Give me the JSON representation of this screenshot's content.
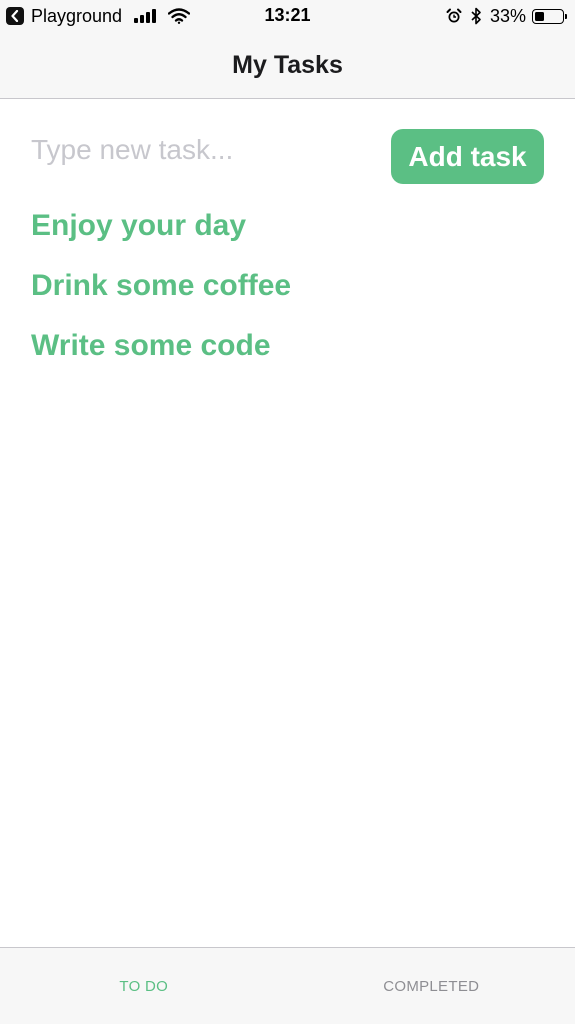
{
  "status_bar": {
    "back_app": "Playground",
    "time": "13:21",
    "battery_percent": "33%",
    "battery_level": 0.33,
    "icons": [
      "back-chevron-icon",
      "signal-icon",
      "wifi-icon",
      "alarm-icon",
      "bluetooth-icon",
      "battery-icon"
    ]
  },
  "nav": {
    "title": "My Tasks"
  },
  "input": {
    "value": "",
    "placeholder": "Type new task..."
  },
  "add_button": {
    "label": "Add task"
  },
  "tasks": [
    {
      "label": "Enjoy your day"
    },
    {
      "label": "Drink some coffee"
    },
    {
      "label": "Write some code"
    }
  ],
  "tabs": [
    {
      "label": "TO DO",
      "active": true
    },
    {
      "label": "COMPLETED",
      "active": false
    }
  ],
  "colors": {
    "accent": "#5bbf84",
    "inactive_tab": "#8e8e93",
    "bar_background": "#f7f7f7",
    "placeholder": "#c7c7cd"
  }
}
